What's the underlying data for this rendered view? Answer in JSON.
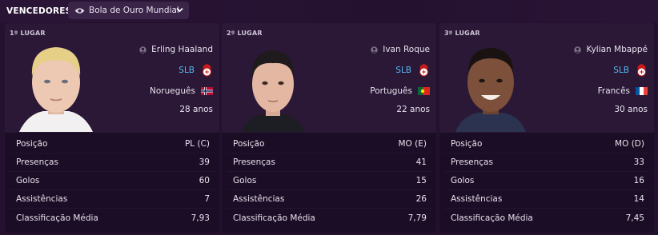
{
  "header": {
    "title": "VENCEDORES",
    "dropdown_label": "Bola de Ouro Mundial"
  },
  "stat_labels": {
    "position": "Posição",
    "apps": "Presenças",
    "goals": "Golos",
    "assists": "Assistências",
    "rating": "Classificação Média"
  },
  "winners": [
    {
      "rank": "1º LUGAR",
      "name": "Erling Haaland",
      "club": "SLB",
      "nationality": "Norueguês",
      "age": "28 anos",
      "position": "PL (C)",
      "apps": "39",
      "goals": "60",
      "assists": "7",
      "rating": "7,93"
    },
    {
      "rank": "2º LUGAR",
      "name": "Ivan Roque",
      "club": "SLB",
      "nationality": "Português",
      "age": "22 anos",
      "position": "MO (E)",
      "apps": "41",
      "goals": "15",
      "assists": "26",
      "rating": "7,79"
    },
    {
      "rank": "3º LUGAR",
      "name": "Kylian Mbappé",
      "club": "SLB",
      "nationality": "Francês",
      "age": "30 anos",
      "position": "MO (D)",
      "apps": "33",
      "goals": "16",
      "assists": "14",
      "rating": "7,45"
    }
  ],
  "colors": {
    "background": "#24112f",
    "card": "#1b0d25",
    "card_header": "#2a1836",
    "club_link": "#53b9f0"
  },
  "icons": [
    "eye-icon",
    "chevron-down-icon",
    "person-icon",
    "benfica-crest-icon",
    "norway-flag-icon",
    "portugal-flag-icon",
    "france-flag-icon"
  ]
}
